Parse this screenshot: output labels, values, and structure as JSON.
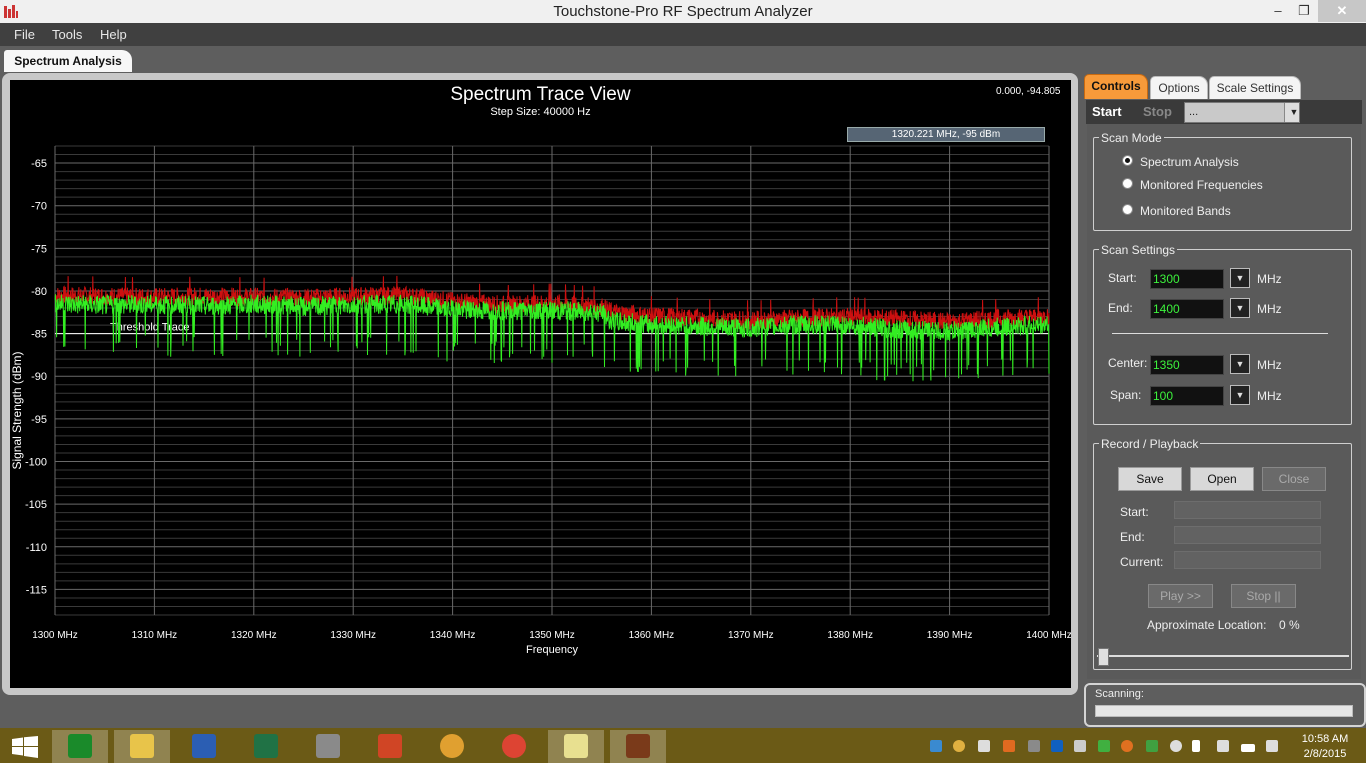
{
  "window": {
    "title": "Touchstone-Pro RF Spectrum Analyzer",
    "minimize": "‒",
    "restore": "❐",
    "close": "✕"
  },
  "menu": [
    "File",
    "Tools",
    "Help"
  ],
  "main_tab": "Spectrum Analysis",
  "chart": {
    "coords": "0.000, -94.805",
    "cursor_readout": "1320.221 MHz,  -95 dBm",
    "threshold_label": "Threshold Trace"
  },
  "chart_data": {
    "type": "line",
    "title": "Spectrum Trace View",
    "subtitle": "Step Size: 40000 Hz",
    "xlabel": "Frequency",
    "ylabel": "Signal Strength (dBm)",
    "xlim": [
      1300,
      1400
    ],
    "ylim": [
      -118,
      -63
    ],
    "x_ticks": [
      "1300 MHz",
      "1310 MHz",
      "1320 MHz",
      "1330 MHz",
      "1340 MHz",
      "1350 MHz",
      "1360 MHz",
      "1370 MHz",
      "1380 MHz",
      "1390 MHz",
      "1400 MHz"
    ],
    "y_ticks": [
      "-65",
      "-70",
      "-75",
      "-80",
      "-85",
      "-90",
      "-95",
      "-100",
      "-105",
      "-110",
      "-115"
    ],
    "grid": true,
    "threshold": -85,
    "series": [
      {
        "color": "#cc1010",
        "x": [
          1300,
          1305,
          1310,
          1315,
          1320,
          1325,
          1330,
          1335,
          1340,
          1345,
          1350,
          1355,
          1356,
          1360,
          1365,
          1370,
          1375,
          1380,
          1385,
          1390,
          1395,
          1400
        ],
        "y": [
          -80.5,
          -80.6,
          -80.7,
          -80.6,
          -80.7,
          -80.8,
          -80.6,
          -80.5,
          -81.2,
          -81.6,
          -81.4,
          -81.8,
          -82.5,
          -82.9,
          -83.2,
          -83.4,
          -83.2,
          -83.0,
          -83.3,
          -83.6,
          -83.2,
          -83.0
        ]
      },
      {
        "color": "#33ee22",
        "x": [
          1300,
          1305,
          1310,
          1315,
          1320,
          1325,
          1330,
          1335,
          1340,
          1345,
          1350,
          1355,
          1356,
          1360,
          1365,
          1370,
          1375,
          1380,
          1385,
          1390,
          1395,
          1400
        ],
        "y": [
          -81.5,
          -81.7,
          -81.6,
          -81.8,
          -81.6,
          -81.9,
          -81.7,
          -81.6,
          -82.2,
          -82.4,
          -82.3,
          -82.6,
          -83.6,
          -84.0,
          -84.2,
          -84.4,
          -84.0,
          -84.1,
          -84.6,
          -84.8,
          -84.3,
          -84.0
        ]
      }
    ]
  },
  "controls": {
    "tabs": [
      "Controls",
      "Options",
      "Scale Settings"
    ],
    "start": "Start",
    "stop": "Stop",
    "selector": "...",
    "scan_mode": {
      "title": "Scan Mode",
      "options": [
        "Spectrum Analysis",
        "Monitored Frequencies",
        "Monitored Bands"
      ],
      "selected": "Spectrum Analysis"
    },
    "scan_settings": {
      "title": "Scan Settings",
      "start_label": "Start:",
      "start_value": "1300",
      "end_label": "End:",
      "end_value": "1400",
      "center_label": "Center:",
      "center_value": "1350",
      "span_label": "Span:",
      "span_value": "100",
      "unit": "MHz"
    },
    "record": {
      "title": "Record / Playback",
      "save": "Save",
      "open": "Open",
      "close": "Close",
      "start_label": "Start:",
      "end_label": "End:",
      "current_label": "Current:",
      "play": "Play >>",
      "stop": "Stop ||",
      "location_label": "Approximate Location:",
      "location_value": "0 %",
      "location_fraction": 0
    }
  },
  "status": {
    "label": "Scanning:",
    "progress": 0
  },
  "taskbar": {
    "time": "10:58 AM",
    "date": "2/8/2015"
  }
}
